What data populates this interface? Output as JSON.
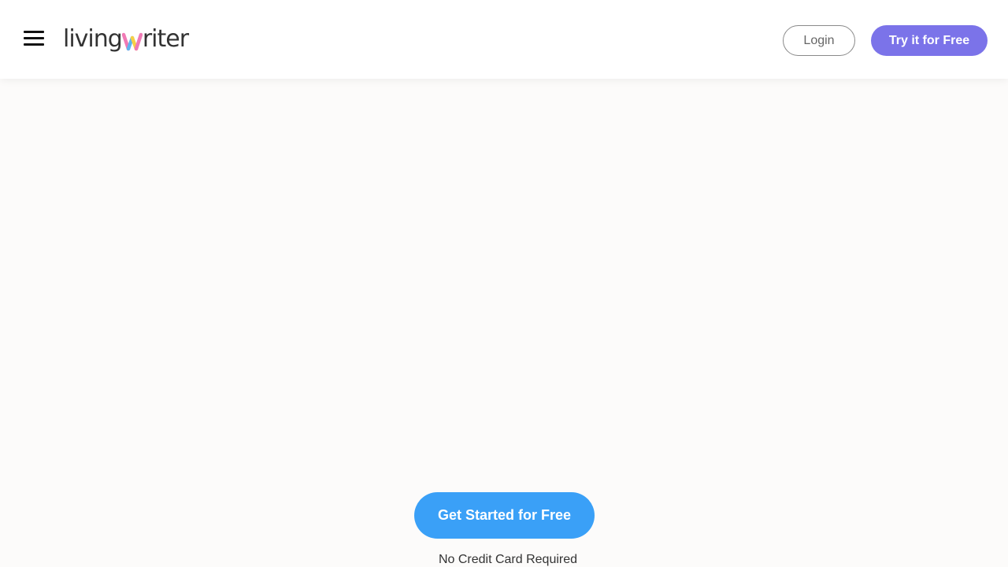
{
  "header": {
    "logo": {
      "text_before": "living",
      "text_after": "riter"
    },
    "login_label": "Login",
    "try_label": "Try it for Free"
  },
  "hero": {
    "cta_label": "Get Started for Free",
    "cta_note": "No Credit Card Required"
  },
  "colors": {
    "accent_purple": "#7b73e9",
    "cta_blue": "#3aa0f7",
    "logo_w_pink": "#f07ab5",
    "logo_w_blue": "#5fb4f0",
    "logo_w_yellow": "#f6cf45"
  }
}
